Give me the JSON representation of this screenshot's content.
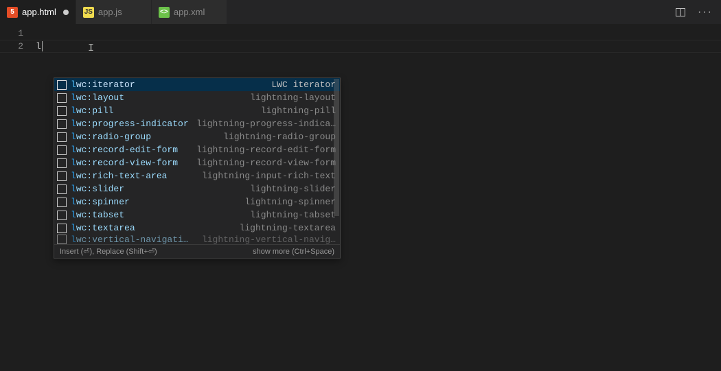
{
  "tabs": [
    {
      "label": "app.html",
      "iconColor": "#e44d26",
      "iconText": "5",
      "active": true,
      "dirty": true
    },
    {
      "label": "app.js",
      "iconColor": "#f0db4f",
      "iconText": "JS",
      "active": false,
      "dirty": false
    },
    {
      "label": "app.xml",
      "iconColor": "#6cc24a",
      "iconText": "<>",
      "active": false,
      "dirty": false
    }
  ],
  "editor": {
    "lineNumbers": [
      "1",
      "2"
    ],
    "typed": "l"
  },
  "suggest": {
    "items": [
      {
        "label": "lwc:iterator",
        "detail": "LWC iterator"
      },
      {
        "label": "lwc:layout",
        "detail": "lightning-layout"
      },
      {
        "label": "lwc:pill",
        "detail": "lightning-pill"
      },
      {
        "label": "lwc:progress-indicator",
        "detail": "lightning-progress-indica…"
      },
      {
        "label": "lwc:radio-group",
        "detail": "lightning-radio-group"
      },
      {
        "label": "lwc:record-edit-form",
        "detail": "lightning-record-edit-form"
      },
      {
        "label": "lwc:record-view-form",
        "detail": "lightning-record-view-form"
      },
      {
        "label": "lwc:rich-text-area",
        "detail": "lightning-input-rich-text"
      },
      {
        "label": "lwc:slider",
        "detail": "lightning-slider"
      },
      {
        "label": "lwc:spinner",
        "detail": "lightning-spinner"
      },
      {
        "label": "lwc:tabset",
        "detail": "lightning-tabset"
      },
      {
        "label": "lwc:textarea",
        "detail": "lightning-textarea"
      }
    ],
    "cutoff": {
      "label": "lwc:vertical-navigati…",
      "detail": "lightning-vertical-navig…"
    },
    "statusLeft": "Insert (⏎), Replace (Shift+⏎)",
    "statusRight": "show more (Ctrl+Space)"
  }
}
